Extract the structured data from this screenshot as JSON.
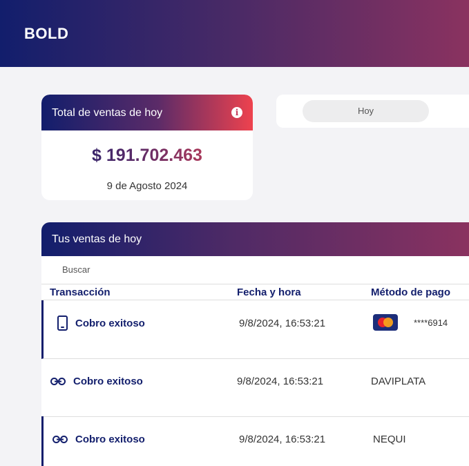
{
  "header": {
    "brand": "BOLD"
  },
  "summary": {
    "title": "Total de ventas de hoy",
    "info_icon": "info-icon",
    "amount": "$ 191.702.463",
    "date": "9 de Agosto 2024"
  },
  "filter": {
    "selected": "Hoy"
  },
  "sales": {
    "title": "Tus ventas de hoy",
    "search_placeholder": "Buscar",
    "columns": [
      "Transacción",
      "Fecha y hora",
      "Método de pago"
    ],
    "rows": [
      {
        "icon": "phone-icon",
        "status": "Cobro exitoso",
        "datetime": "9/8/2024, 16:53:21",
        "method": "",
        "card_icon": "mastercard-icon",
        "masked": "****6914"
      },
      {
        "icon": "link-icon",
        "status": "Cobro exitoso",
        "datetime": "9/8/2024, 16:53:21",
        "method": "DAVIPLATA"
      },
      {
        "icon": "link-icon",
        "status": "Cobro exitoso",
        "datetime": "9/8/2024, 16:53:21",
        "method": "NEQUI"
      }
    ]
  },
  "colors": {
    "primary": "#121e6c",
    "accent": "#ee424e",
    "background": "#f3f3f6"
  }
}
